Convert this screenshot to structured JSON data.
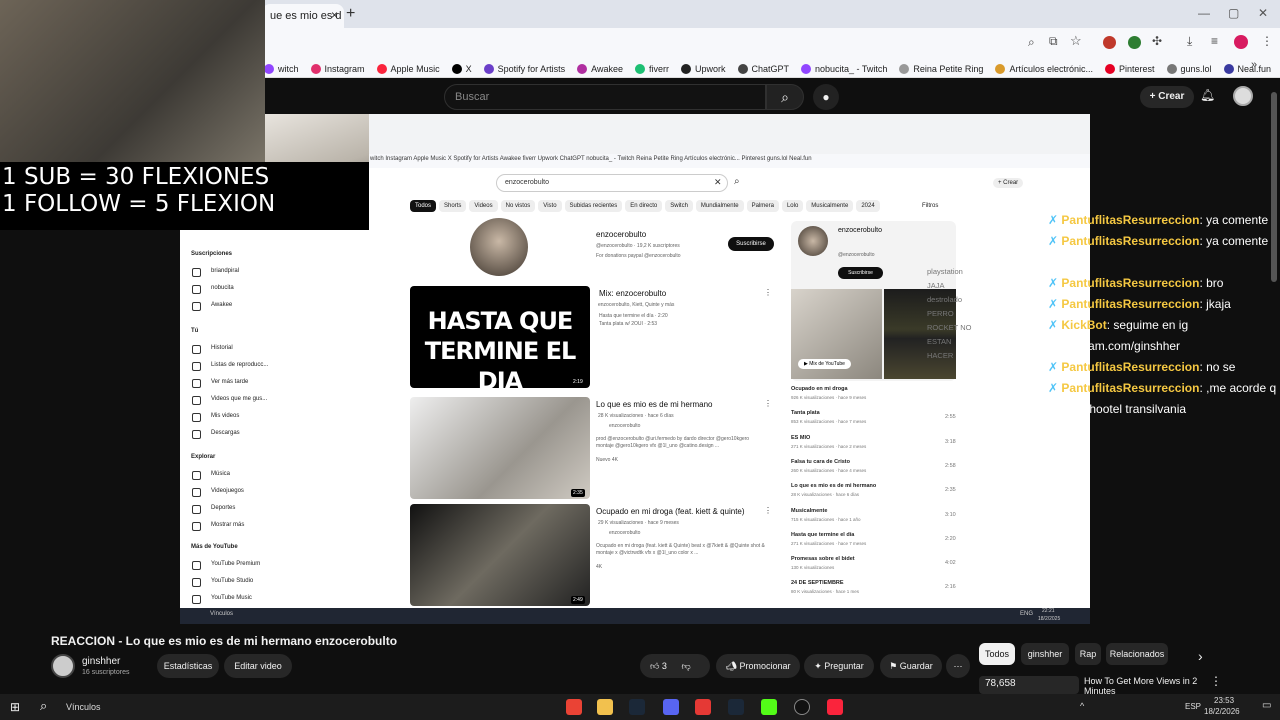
{
  "browser": {
    "tab_title": "ue es mio es d",
    "bookmarks": [
      {
        "label": "witch",
        "color": "#9146ff"
      },
      {
        "label": "Instagram",
        "color": "#e1306c"
      },
      {
        "label": "Apple Music",
        "color": "#fa243c"
      },
      {
        "label": "X",
        "color": "#000000"
      },
      {
        "label": "Spotify for Artists",
        "color": "#6b3fc9"
      },
      {
        "label": "Awakee",
        "color": "#b02ea0"
      },
      {
        "label": "fiverr",
        "color": "#1dbf73"
      },
      {
        "label": "Upwork",
        "color": "#222222"
      },
      {
        "label": "ChatGPT",
        "color": "#444444"
      },
      {
        "label": "nobucita_ - Twitch",
        "color": "#9146ff"
      },
      {
        "label": "Reina Petite Ring",
        "color": "#999999"
      },
      {
        "label": "Artículos electrónic...",
        "color": "#d99a2b"
      },
      {
        "label": "Pinterest",
        "color": "#e60023"
      },
      {
        "label": "guns.lol",
        "color": "#777777"
      },
      {
        "label": "Neal.fun",
        "color": "#3a3aa0"
      }
    ]
  },
  "youtube": {
    "search_placeholder": "Buscar",
    "create_label": "Crear"
  },
  "stream_overlay": {
    "line1": "1 SUB = 30 FLEXIONES",
    "line2": "1 FOLLOW = 5 FLEXION"
  },
  "inner": {
    "search_value": "enzocerobulto",
    "create_label": "Crear",
    "filters_label": "Filtros",
    "bookmarks_line": "witch   Instagram   Apple Music   X   Spotify for Artists   Awakee   fiverr   Upwork   ChatGPT   nobucita_ - Twitch   Reina Petite Ring   Artículos electrónic...   Pinterest   guns.lol   Neal.fun",
    "chips": [
      "Todos",
      "Shorts",
      "Videos",
      "No vistos",
      "Visto",
      "Subidas recientes",
      "En directo",
      "Switch",
      "Mundialmente",
      "Palmera",
      "Lolo",
      "Musicalmente",
      "2024"
    ],
    "sidebar": {
      "subs_title": "Suscripciones",
      "subs": [
        "briandpiral",
        "nobucita",
        "Awakee"
      ],
      "you_title": "Tú",
      "you_items": [
        "Historial",
        "Listas de reproducc...",
        "Ver más tarde",
        "Videos que me gus...",
        "Mis videos",
        "Descargas"
      ],
      "explore_title": "Explorar",
      "explore_items": [
        "Música",
        "Videojuegos",
        "Deportes",
        "Mostrar más"
      ],
      "more_title": "Más de YouTube",
      "more_items": [
        "YouTube Premium",
        "YouTube Studio",
        "YouTube Music"
      ]
    },
    "channel": {
      "name": "enzocerobulto",
      "handle_line": "@enzocerobulto · 19,2 K suscriptores",
      "desc": "For donations paypal @enzocerobulto",
      "subscribe": "Suscribirse"
    },
    "videos": [
      {
        "title": "Mix: enzocerobulto",
        "meta": "enzocerobulto, Kiett, Quinte y más",
        "meta2": "Hasta que termine el día · 2:20",
        "meta3": "Tanta plata w/ 2OUI · 2:53",
        "duration": "2:19",
        "thumb_text": "HASTA QUE TERMINE EL DIA"
      },
      {
        "title": "Lo que es mio es de mi hermano",
        "meta": "28 K visualizaciones · hace 6 días",
        "channel": "enzocerobulto",
        "desc": "prod @enzocerobulto @uri.fermedo by dardo director @gero10kgero montaje @gero10kgero vfx @1l_uno @catino.design ...",
        "badge": "Nuevo   4K",
        "duration": "2:35"
      },
      {
        "title": "Ocupado en mi droga (feat. kiett & quinte)",
        "meta": "29 K visualizaciones · hace 9 meses",
        "channel": "enzocerobulto",
        "desc": "Ocupado en mi droga (feat. kiett & Quinte) beat x @7kiett & @Quinte shot & montaje x @victrwdtk vfx x @1l_uno color x ...",
        "badge": "4K",
        "duration": "2:49"
      }
    ],
    "right_card": {
      "name": "enzocerobulto",
      "handle": "@enzocerobulto",
      "subscribe": "Suscribirse",
      "mix_label": "Mix de YouTube"
    },
    "right_list": [
      {
        "title": "Ocupado en mi droga",
        "meta": "926 K visualizaciones · hace 9 meses",
        "dur": ""
      },
      {
        "title": "Tanta plata",
        "meta": "853 K visualizaciones · hace 7 meses",
        "dur": "2:55"
      },
      {
        "title": "ES MIO",
        "meta": "271 K visualizaciones · hace 2 meses",
        "dur": "3:18"
      },
      {
        "title": "Falsa tu cara de Cristo",
        "meta": "260 K visualizaciones · hace 4 meses",
        "dur": "2:58"
      },
      {
        "title": "Lo que es mio es de mi hermano",
        "meta": "28 K visualizaciones · hace 6 días",
        "dur": "2:35"
      },
      {
        "title": "Musicalmente",
        "meta": "715 K visualizaciones · hace 1 año",
        "dur": "3:10"
      },
      {
        "title": "Hasta que termine el día",
        "meta": "271 K visualizaciones · hace 7 meses",
        "dur": "2:20"
      },
      {
        "title": "Promesas sobre el bidet",
        "meta": "130 K visualizaciones",
        "dur": "4:02"
      },
      {
        "title": "24 DE SEPTIEMBRE",
        "meta": "80 K visualizaciones · hace 1 mes",
        "dur": "2:16"
      }
    ],
    "taskbar_search": "Vínculos",
    "clock_time": "22:21",
    "clock_date": "18/2/2025",
    "lang": "ENG"
  },
  "chat": [
    {
      "user": "PantuflitasResurreccion",
      "msg": "ya comente"
    },
    {
      "user": "PantuflitasResurreccion",
      "msg": "ya comente"
    },
    {
      "user": "",
      "msg": "bro"
    },
    {
      "user": "PantuflitasResurreccion",
      "msg": "bro"
    },
    {
      "user": "PantuflitasResurreccion",
      "msg": "jkaja"
    },
    {
      "user": "KickBot",
      "msg": "seguime en ig"
    },
    {
      "user": "",
      "msg": "instagram.com/ginshher"
    },
    {
      "user": "PantuflitasResurreccion",
      "msg": "no se"
    },
    {
      "user": "PantuflitasResurreccion",
      "msg": ",me acorde q"
    },
    {
      "user": "",
      "msg": "existia hootel transilvania"
    }
  ],
  "ghost_chat": [
    "playstation",
    "JAJA",
    "destrolado",
    "PERRO",
    "ROCKET NO",
    "ESTAN",
    "HACER"
  ],
  "video": {
    "title": "REACCION - Lo que es mio es de mi hermano enzocerobulto",
    "channel": "ginshher",
    "subs": "16 suscriptores",
    "stats_btn": "Estadísticas",
    "edit_btn": "Editar video",
    "likes": "3",
    "promote": "Promocionar",
    "ask": "Preguntar",
    "save": "Guardar"
  },
  "tags": [
    "Todos",
    "ginshher",
    "Rap",
    "Relacionados"
  ],
  "up_next": {
    "views": "78,658",
    "title": "How To Get More Views in 2 Minutes"
  },
  "taskbar": {
    "search": "Vínculos",
    "lang": "ESP",
    "time": "23:53",
    "date": "18/2/2026"
  }
}
